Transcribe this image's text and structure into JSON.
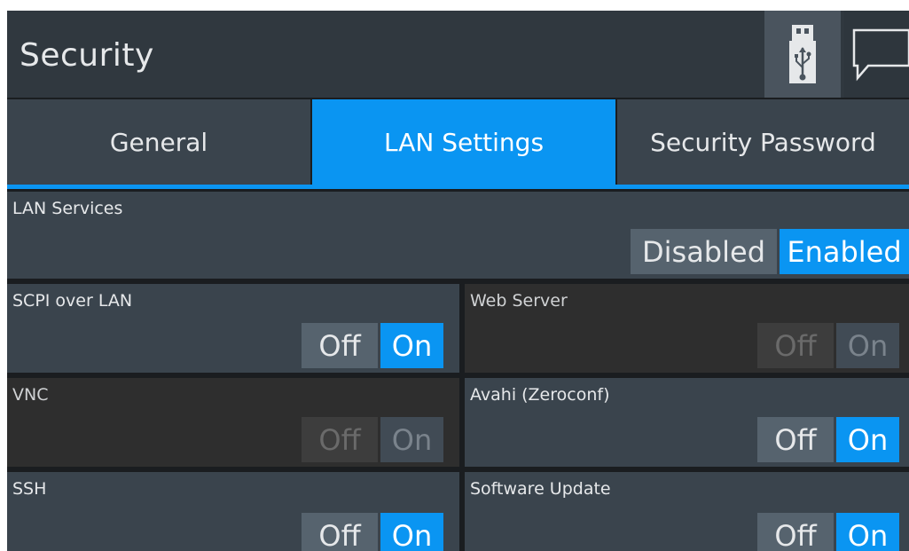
{
  "header": {
    "title": "Security",
    "icons": [
      "usb-icon",
      "message-icon"
    ]
  },
  "tabs": [
    {
      "label": "General",
      "active": false
    },
    {
      "label": "LAN Settings",
      "active": true
    },
    {
      "label": "Security Password",
      "active": false
    }
  ],
  "lan_services": {
    "label": "LAN Services",
    "options": [
      "Disabled",
      "Enabled"
    ],
    "selected": "Enabled"
  },
  "services": [
    {
      "label": "SCPI over LAN",
      "off": "Off",
      "on": "On",
      "selected": "On",
      "enabled": true
    },
    {
      "label": "Web Server",
      "off": "Off",
      "on": "On",
      "selected": "On",
      "enabled": false
    },
    {
      "label": "VNC",
      "off": "Off",
      "on": "On",
      "selected": "On",
      "enabled": false
    },
    {
      "label": "Avahi (Zeroconf)",
      "off": "Off",
      "on": "On",
      "selected": "On",
      "enabled": true
    },
    {
      "label": "SSH",
      "off": "Off",
      "on": "On",
      "selected": "On",
      "enabled": true
    },
    {
      "label": "Software Update",
      "off": "Off",
      "on": "On",
      "selected": "On",
      "enabled": true
    }
  ],
  "colors": {
    "accent": "#0a95f2",
    "panel": "#3a444d",
    "disabled_panel": "#2e2e2e",
    "header": "#30383f"
  }
}
